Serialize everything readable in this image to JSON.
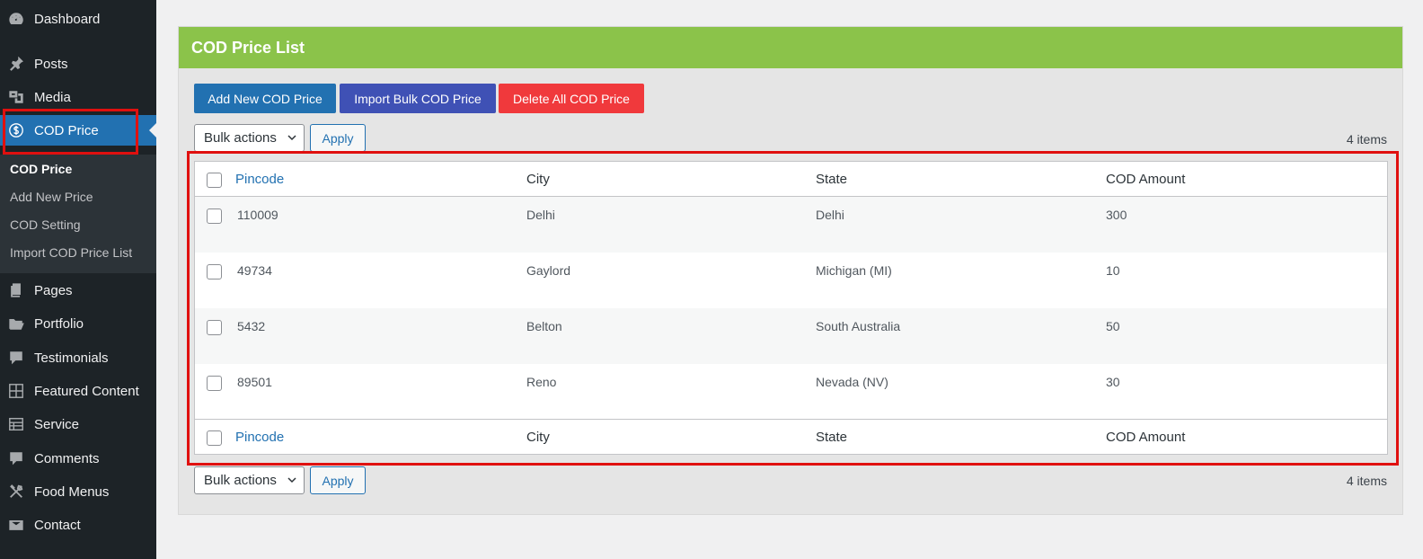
{
  "sidebar": {
    "items": [
      {
        "label": "Dashboard",
        "icon": "dashboard-icon"
      },
      {
        "label": "Posts",
        "icon": "pin-icon"
      },
      {
        "label": "Media",
        "icon": "media-icon"
      },
      {
        "label": "COD Price",
        "icon": "dollar-circle-icon"
      },
      {
        "label": "Pages",
        "icon": "pages-icon"
      },
      {
        "label": "Portfolio",
        "icon": "folder-icon"
      },
      {
        "label": "Testimonials",
        "icon": "testimonial-icon"
      },
      {
        "label": "Featured Content",
        "icon": "grid-icon"
      },
      {
        "label": "Service",
        "icon": "service-icon"
      },
      {
        "label": "Comments",
        "icon": "comment-icon"
      },
      {
        "label": "Food Menus",
        "icon": "utensils-icon"
      },
      {
        "label": "Contact",
        "icon": "mail-icon"
      }
    ],
    "submenu": [
      "COD Price",
      "Add New Price",
      "COD Setting",
      "Import COD Price List"
    ]
  },
  "panel": {
    "title": "COD Price List",
    "buttons": {
      "add": "Add New COD Price",
      "import": "Import Bulk COD Price",
      "delete": "Delete All COD Price"
    },
    "bulk_actions": "Bulk actions",
    "apply": "Apply",
    "items_count": "4 items"
  },
  "table": {
    "columns": [
      "Pincode",
      "City",
      "State",
      "COD Amount"
    ],
    "rows": [
      [
        "110009",
        "Delhi",
        "Delhi",
        "300"
      ],
      [
        "49734",
        "Gaylord",
        "Michigan (MI)",
        "10"
      ],
      [
        "5432",
        "Belton",
        "South Australia",
        "50"
      ],
      [
        "89501",
        "Reno",
        "Nevada (NV)",
        "30"
      ]
    ]
  },
  "colors": {
    "sidebar_bg": "#1d2327",
    "active_menu": "#2271b1",
    "panel_header": "#8bc34a",
    "add_button": "#2271b1",
    "import_button": "#3f51b5",
    "delete_button": "#f0393c",
    "highlight": "#e0100f"
  }
}
